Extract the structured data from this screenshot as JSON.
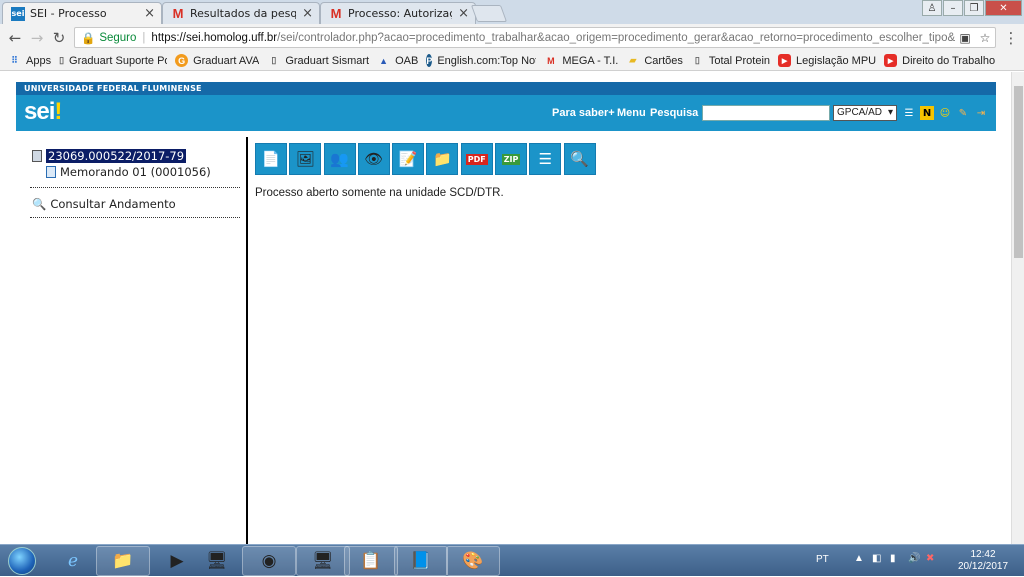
{
  "browser": {
    "tabs": [
      {
        "title": "SEI - Processo",
        "favicon": "sei-icon",
        "active": true
      },
      {
        "title": "Resultados da pesquisa -",
        "favicon": "gmail-icon",
        "active": false
      },
      {
        "title": "Processo: Autorização pa",
        "favicon": "gmail-icon",
        "active": false
      }
    ],
    "secure_label": "Seguro",
    "url_host": "https://sei.homolog.uff.br",
    "url_rest": "/sei/controlador.php?acao=procedimento_trabalhar&acao_origem=procedimento_gerar&acao_retorno=procedimento_escolher_tipo&i...",
    "bookmarks": [
      {
        "label": "Apps",
        "icon": "apps-grid-icon"
      },
      {
        "label": "Graduart Suporte Po",
        "icon": "page-icon"
      },
      {
        "label": "Graduart AVA",
        "icon": "g-icon"
      },
      {
        "label": "Graduart Sismart",
        "icon": "page-icon"
      },
      {
        "label": "OAB",
        "icon": "oab-icon"
      },
      {
        "label": "English.com:Top Not",
        "icon": "p-icon"
      },
      {
        "label": "MEGA - T.I.",
        "icon": "mega-icon"
      },
      {
        "label": "Cartões",
        "icon": "folder-icon"
      },
      {
        "label": "Total Protein",
        "icon": "page-icon"
      },
      {
        "label": "Legislação MPU",
        "icon": "youtube-icon"
      },
      {
        "label": "Direito do Trabalho",
        "icon": "youtube-icon"
      }
    ]
  },
  "sei": {
    "institution": "UNIVERSIDADE FEDERAL FLUMINENSE",
    "logo": "sei",
    "logo_bang": "!",
    "menu_saber": "Para saber+",
    "menu_menu": "Menu",
    "menu_pesquisa": "Pesquisa",
    "unit_select": "GPCA/AD",
    "tree": {
      "process_number": "23069.000522/2017-79",
      "document": "Memorando 01 (0001056)",
      "consult_link": "Consultar Andamento"
    },
    "toolbar_icons": [
      "new-document-icon",
      "start-related-process-icon",
      "assign-process-icon",
      "follow-up-icon",
      "annotation-icon",
      "folder-icon",
      "pdf-icon",
      "zip-icon",
      "list-icon",
      "search-icon"
    ],
    "message": "Processo aberto somente na unidade SCD/DTR."
  },
  "taskbar": {
    "lang": "PT",
    "time": "12:42",
    "date": "20/12/2017"
  },
  "colors": {
    "sei_blue": "#1b94c9",
    "uff_blue": "#1569a8",
    "selection": "#0b1d66"
  }
}
